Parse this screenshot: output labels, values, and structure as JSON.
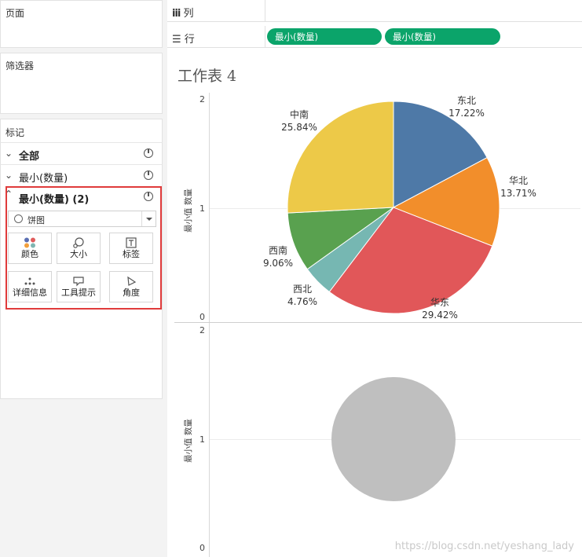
{
  "left_panel": {
    "pages_title": "页面",
    "filters_title": "筛选器",
    "marks_title": "标记",
    "marks_rows": [
      {
        "label": "全部",
        "bold": true
      },
      {
        "label": "最小(数量)",
        "bold": false
      },
      {
        "label": "最小(数量) (2)",
        "bold": true
      }
    ],
    "mark_type": "饼图",
    "tiles": [
      "颜色",
      "大小",
      "标签",
      "详细信息",
      "工具提示",
      "角度"
    ]
  },
  "shelves": {
    "columns_label": "列",
    "rows_label": "行",
    "row_pills": [
      "最小(数量)",
      "最小(数量)"
    ]
  },
  "sheet_title": "工作表 4",
  "axis": {
    "title": "最小值 数量",
    "ticks": [
      "2",
      "1",
      "0"
    ]
  },
  "colors": {
    "pill": "#0ba46a",
    "highlight": "#e03b3b",
    "grey_circle": "#bfbfbf"
  },
  "chart_data": [
    {
      "type": "pie",
      "slices": [
        {
          "name": "东北",
          "value": 17.22,
          "label": "17.22%",
          "color": "#4e79a7"
        },
        {
          "name": "华北",
          "value": 13.71,
          "label": "13.71%",
          "color": "#f28e2b"
        },
        {
          "name": "华东",
          "value": 29.42,
          "label": "29.42%",
          "color": "#e15759"
        },
        {
          "name": "西北",
          "value": 4.76,
          "label": "4.76%",
          "color": "#76b7b2"
        },
        {
          "name": "西南",
          "value": 9.06,
          "label": "9.06%",
          "color": "#59a14f"
        },
        {
          "name": "中南",
          "value": 25.84,
          "label": "25.84%",
          "color": "#edc948"
        }
      ],
      "ylabel": "最小值 数量",
      "ylim": [
        0,
        2
      ],
      "y_center": 1
    },
    {
      "type": "pie",
      "slices": [
        {
          "value": 100,
          "color": "#bfbfbf"
        }
      ],
      "ylabel": "最小值 数量",
      "ylim": [
        0,
        2
      ],
      "y_center": 1
    }
  ],
  "watermark": "https://blog.csdn.net/yeshang_lady"
}
